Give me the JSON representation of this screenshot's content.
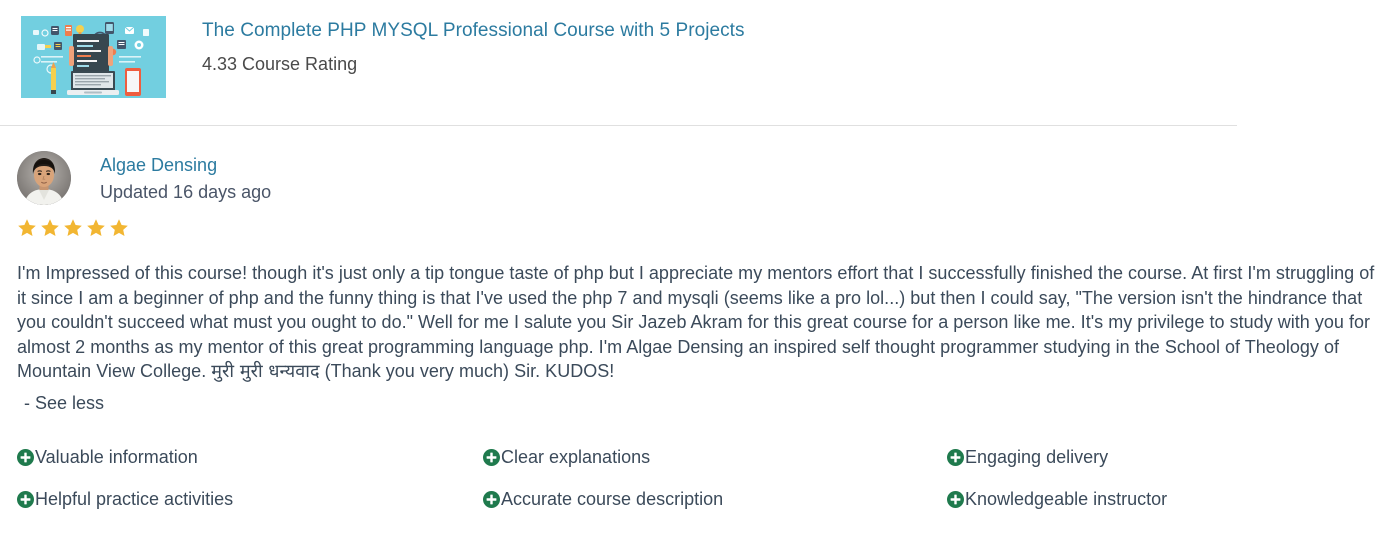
{
  "course": {
    "title": "The Complete PHP MYSQL Professional Course with 5 Projects",
    "rating_text": "4.33 Course Rating",
    "thumbnail_icon": "course-thumbnail-illustration",
    "thumbnail_bg": "#72cfe0"
  },
  "review": {
    "avatar_icon": "reviewer-avatar-photo",
    "reviewer_name": "Algae Densing",
    "updated_text": "Updated 16 days ago",
    "star_count": 5,
    "star_icon": "star-icon",
    "star_color": "#f2b632",
    "text_part1": "I'm Impressed of this course! though it's just only a tip tongue taste of php but I appreciate my mentors effort that I successfully finished the course. At first I'm struggling of it since I am a beginner of php and the funny thing is that I've used the php 7 and mysqli (seems like a pro lol...) but then I could say, \"The version isn't the hindrance that you couldn't succeed what must you ought to do.\" Well for me I salute you Sir Jazeb Akram for this great course for a person like me. It's my privilege to study with you for almost 2 months as my mentor of this great programming language php. I'm Algae Densing an inspired self thought programmer studying in the School of Theology of Mountain View College. ",
    "text_devanagari": "मुरी मुरी धन्यवाद",
    "text_part2": " (Thank you very much) Sir. KUDOS!",
    "see_less_label": "- See less"
  },
  "feedback": {
    "icon_name": "plus-circle-icon",
    "icon_color": "#1f7a4d",
    "tags": [
      "Valuable information",
      "Clear explanations",
      "Engaging delivery",
      "Helpful practice activities",
      "Accurate course description",
      "Knowledgeable instructor"
    ]
  },
  "colors": {
    "link": "#2c7ba0",
    "text": "#3b4a5a",
    "divider": "#e0e0e0"
  }
}
